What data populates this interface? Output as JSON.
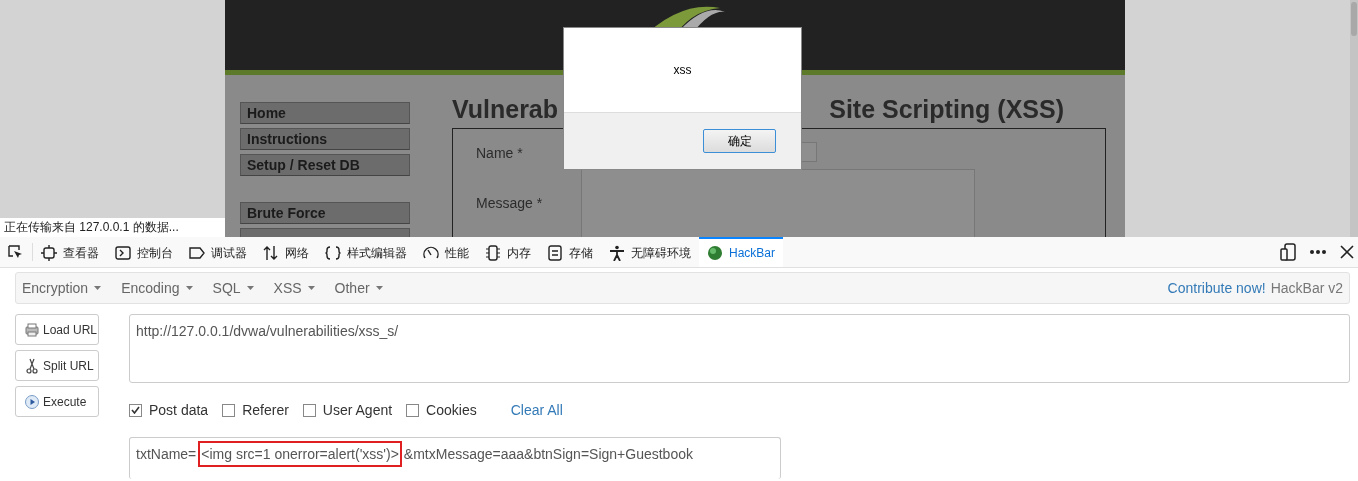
{
  "browser_page": {
    "menu_groups": [
      [
        {
          "label": "Home"
        },
        {
          "label": "Instructions"
        },
        {
          "label": "Setup / Reset DB"
        }
      ],
      [
        {
          "label": "Brute Force"
        }
      ]
    ],
    "title_left": "Vulnerab",
    "title_right": "Site Scripting (XSS)",
    "form": {
      "name_label": "Name *",
      "message_label": "Message *"
    },
    "status_text": "正在传输来自 127.0.0.1 的数据..."
  },
  "alert_dialog": {
    "message": "xss",
    "ok_button": "确定"
  },
  "devtools": {
    "tools": [
      {
        "kind": "inspector",
        "label": "查看器",
        "selected": false
      },
      {
        "kind": "console",
        "label": "控制台",
        "selected": false
      },
      {
        "kind": "debugger",
        "label": "调试器",
        "selected": false
      },
      {
        "kind": "network",
        "label": "网络",
        "selected": false
      },
      {
        "kind": "style",
        "label": "样式编辑器",
        "selected": false
      },
      {
        "kind": "performance",
        "label": "性能",
        "selected": false
      },
      {
        "kind": "memory",
        "label": "内存",
        "selected": false
      },
      {
        "kind": "storage",
        "label": "存储",
        "selected": false
      },
      {
        "kind": "accessibility",
        "label": "无障碍环境",
        "selected": false
      },
      {
        "kind": "hackbar",
        "label": "HackBar",
        "selected": true
      }
    ]
  },
  "hackbar": {
    "menu": [
      {
        "label": "Encryption"
      },
      {
        "label": "Encoding"
      },
      {
        "label": "SQL"
      },
      {
        "label": "XSS"
      },
      {
        "label": "Other"
      }
    ],
    "contribute_link": "Contribute now!",
    "version": "HackBar v2",
    "actions": [
      {
        "kind": "load",
        "label": "Load URL"
      },
      {
        "kind": "split",
        "label": "Split URL"
      },
      {
        "kind": "execute",
        "label": "Execute"
      }
    ],
    "url_field": {
      "value": "http://127.0.0.1/dvwa/vulnerabilities/xss_s/"
    },
    "options": [
      {
        "label": "Post data",
        "checked": true
      },
      {
        "label": "Referer",
        "checked": false
      },
      {
        "label": "User Agent",
        "checked": false
      },
      {
        "label": "Cookies",
        "checked": false
      }
    ],
    "clear_all": "Clear All",
    "post_data": {
      "parts": [
        {
          "text": "txtName=",
          "highlighted": false
        },
        {
          "text": "<img src=1 onerror=alert('xss')>",
          "highlighted": true
        },
        {
          "text": "&mtxMessage=aaa&btnSign=Sign+Guestbook",
          "highlighted": false
        }
      ]
    }
  }
}
